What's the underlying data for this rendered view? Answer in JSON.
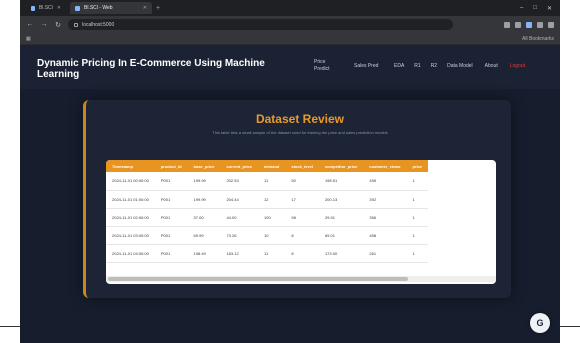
{
  "browser": {
    "tabs": [
      {
        "label": "Bl.SCl"
      },
      {
        "label": "Bl.SCl - Web"
      }
    ],
    "new_tab": "+",
    "window_controls": [
      "–",
      "□",
      "✕"
    ],
    "url": "localhost:5000",
    "bookmarks_right": "All Bookmarks"
  },
  "navbar": {
    "brand": "Dynamic Pricing In E-Commerce Using Machine Learning",
    "links": [
      "Price Predict",
      "Sales Pred",
      "EDA",
      "R1",
      "R2",
      "Data Model",
      "About",
      "Logout"
    ],
    "logout_color": "#e53935"
  },
  "card": {
    "title": "Dataset Review",
    "subtitle": "This table lists a small sample of the dataset used for training the price and sales prediction models",
    "accent_color": "#e89420"
  },
  "table": {
    "columns": [
      "Timestamp",
      "product_id",
      "base_price",
      "current_price",
      "demand",
      "stock_level",
      "competitor_price",
      "customer_views",
      "price"
    ],
    "rows": [
      [
        "2024-11-01 00:00:00",
        "P001",
        "199.99",
        "202.53",
        "11",
        "50",
        "198.51",
        "455",
        "1"
      ],
      [
        "2024-11-01 01:00:00",
        "P001",
        "199.99",
        "204.44",
        "12",
        "17",
        "200.13",
        "392",
        "1"
      ],
      [
        "2024-11-01 02:00:00",
        "P001",
        "37.00",
        "44.00",
        "100",
        "98",
        "29.91",
        "356",
        "1"
      ],
      [
        "2024-11-01 03:00:00",
        "P001",
        "69.99",
        "73.26",
        "10",
        "8",
        "69.01",
        "458",
        "1"
      ],
      [
        "2024-11-01 04:00:00",
        "P001",
        "198.49",
        "183.12",
        "11",
        "8",
        "173.00",
        "261",
        "1"
      ]
    ]
  },
  "fab": {
    "label": "G"
  }
}
